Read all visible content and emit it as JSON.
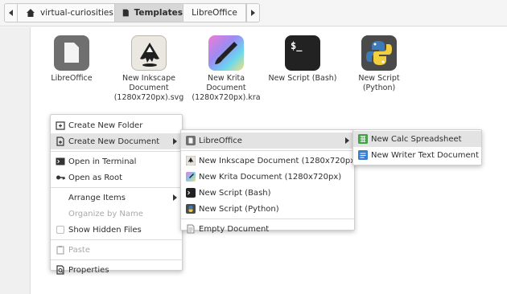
{
  "pathbar": {
    "home_label": "virtual-curiosities",
    "templates_label": "Templates",
    "libreoffice_label": "LibreOffice"
  },
  "files": [
    {
      "label": "LibreOffice",
      "icon": "folder-libreoffice-icon"
    },
    {
      "label": "New Inkscape\nDocument\n(1280x720px).svg",
      "icon": "inkscape-icon"
    },
    {
      "label": "New Krita\nDocument\n(1280x720px).kra",
      "icon": "krita-icon"
    },
    {
      "label": "New Script (Bash)",
      "icon": "terminal-icon",
      "glyph": "$_"
    },
    {
      "label": "New Script\n(Python)",
      "icon": "python-icon"
    }
  ],
  "context_menu": {
    "create_folder": "Create New Folder",
    "create_document": "Create New Document",
    "open_terminal": "Open in Terminal",
    "open_root": "Open as Root",
    "arrange_items": "Arrange Items",
    "organize_by_name": "Organize by Name",
    "show_hidden": "Show Hidden Files",
    "paste": "Paste",
    "properties": "Properties"
  },
  "document_submenu": {
    "libreoffice": "LibreOffice",
    "inkscape": "New Inkscape Document (1280x720px)",
    "krita": "New Krita Document (1280x720px)",
    "bash": "New Script (Bash)",
    "python": "New Script (Python)",
    "empty": "Empty Document"
  },
  "libreoffice_submenu": {
    "calc": "New Calc Spreadsheet",
    "writer": "New Writer Text Document"
  },
  "colors": {
    "calc_green": "#3fa046",
    "writer_blue": "#3a7fcf",
    "highlight": "#e3e3e3"
  }
}
